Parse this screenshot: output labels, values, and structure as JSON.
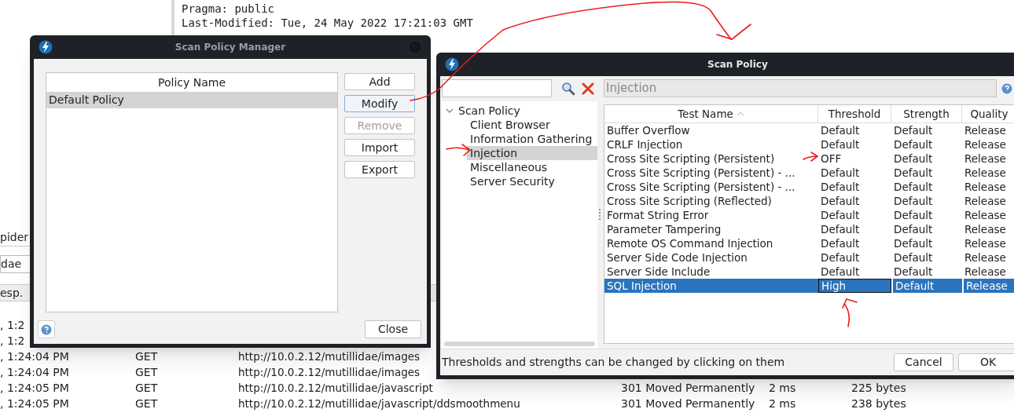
{
  "background": {
    "header_lines": [
      "Pragma: public",
      "Last-Modified: Tue, 24 May 2022 17:21:03 GMT"
    ],
    "tab_label": "pider",
    "dropdown_value": "dae",
    "column_header": "esp.",
    "rows": [
      {
        "time": ", 1:2"
      },
      {
        "time": ", 1:2"
      },
      {
        "time": ", 1:24:04 PM",
        "method": "GET",
        "url": "http://10.0.2.12/mutillidae/images"
      },
      {
        "time": ", 1:24:04 PM",
        "method": "GET",
        "url": "http://10.0.2.12/mutillidae/images"
      },
      {
        "time": ", 1:24:05 PM",
        "method": "GET",
        "url": "http://10.0.2.12/mutillidae/javascript",
        "status": "301 Moved Permanently",
        "duration": "2 ms",
        "size": "225 bytes"
      },
      {
        "time": ", 1:24:05 PM",
        "method": "GET",
        "url": "http://10.0.2.12/mutillidae/javascript/ddsmoothmenu",
        "status": "301 Moved Permanently",
        "duration": "2 ms",
        "size": "238 bytes"
      }
    ]
  },
  "manager": {
    "title": "Scan Policy Manager",
    "column": "Policy Name",
    "policies": [
      {
        "name": "Default Policy",
        "selected": true
      }
    ],
    "buttons": [
      {
        "label": "Add",
        "disabled": false,
        "focused": false
      },
      {
        "label": "Modify",
        "disabled": false,
        "focused": true
      },
      {
        "label": "Remove",
        "disabled": true,
        "focused": false
      },
      {
        "label": "Import",
        "disabled": false,
        "focused": false
      },
      {
        "label": "Export",
        "disabled": false,
        "focused": false
      }
    ],
    "close_button": "Close"
  },
  "policy": {
    "title": "Scan Policy",
    "category_field": "Injection",
    "tree": [
      {
        "label": "Scan Policy",
        "expanded": true,
        "selected": false,
        "children": [
          {
            "label": "Client Browser",
            "selected": false
          },
          {
            "label": "Information Gathering",
            "selected": false
          },
          {
            "label": "Injection",
            "selected": true
          },
          {
            "label": "Miscellaneous",
            "selected": false
          },
          {
            "label": "Server Security",
            "selected": false
          }
        ]
      }
    ],
    "columns": [
      {
        "label": "Test Name",
        "sorted": true
      },
      {
        "label": "Threshold"
      },
      {
        "label": "Strength"
      },
      {
        "label": "Quality"
      }
    ],
    "rows": [
      {
        "name": "Buffer Overflow",
        "threshold": "Default",
        "strength": "Default",
        "quality": "Release",
        "selected": false
      },
      {
        "name": "CRLF Injection",
        "threshold": "Default",
        "strength": "Default",
        "quality": "Release",
        "selected": false
      },
      {
        "name": "Cross Site Scripting (Persistent)",
        "threshold": "OFF",
        "strength": "Default",
        "quality": "Release",
        "selected": false
      },
      {
        "name": "Cross Site Scripting (Persistent) - ...",
        "threshold": "Default",
        "strength": "Default",
        "quality": "Release",
        "selected": false
      },
      {
        "name": "Cross Site Scripting (Persistent) - ...",
        "threshold": "Default",
        "strength": "Default",
        "quality": "Release",
        "selected": false
      },
      {
        "name": "Cross Site Scripting (Reflected)",
        "threshold": "Default",
        "strength": "Default",
        "quality": "Release",
        "selected": false
      },
      {
        "name": "Format String Error",
        "threshold": "Default",
        "strength": "Default",
        "quality": "Release",
        "selected": false
      },
      {
        "name": "Parameter Tampering",
        "threshold": "Default",
        "strength": "Default",
        "quality": "Release",
        "selected": false
      },
      {
        "name": "Remote OS Command Injection",
        "threshold": "Default",
        "strength": "Default",
        "quality": "Release",
        "selected": false
      },
      {
        "name": "Server Side Code Injection",
        "threshold": "Default",
        "strength": "Default",
        "quality": "Release",
        "selected": false
      },
      {
        "name": "Server Side Include",
        "threshold": "Default",
        "strength": "Default",
        "quality": "Release",
        "selected": false
      },
      {
        "name": "SQL Injection",
        "threshold": "High",
        "strength": "Default",
        "quality": "Release",
        "selected": true
      }
    ],
    "status_text": "Thresholds and strengths can be changed by clicking on them",
    "buttons": [
      "Cancel",
      "OK"
    ]
  }
}
